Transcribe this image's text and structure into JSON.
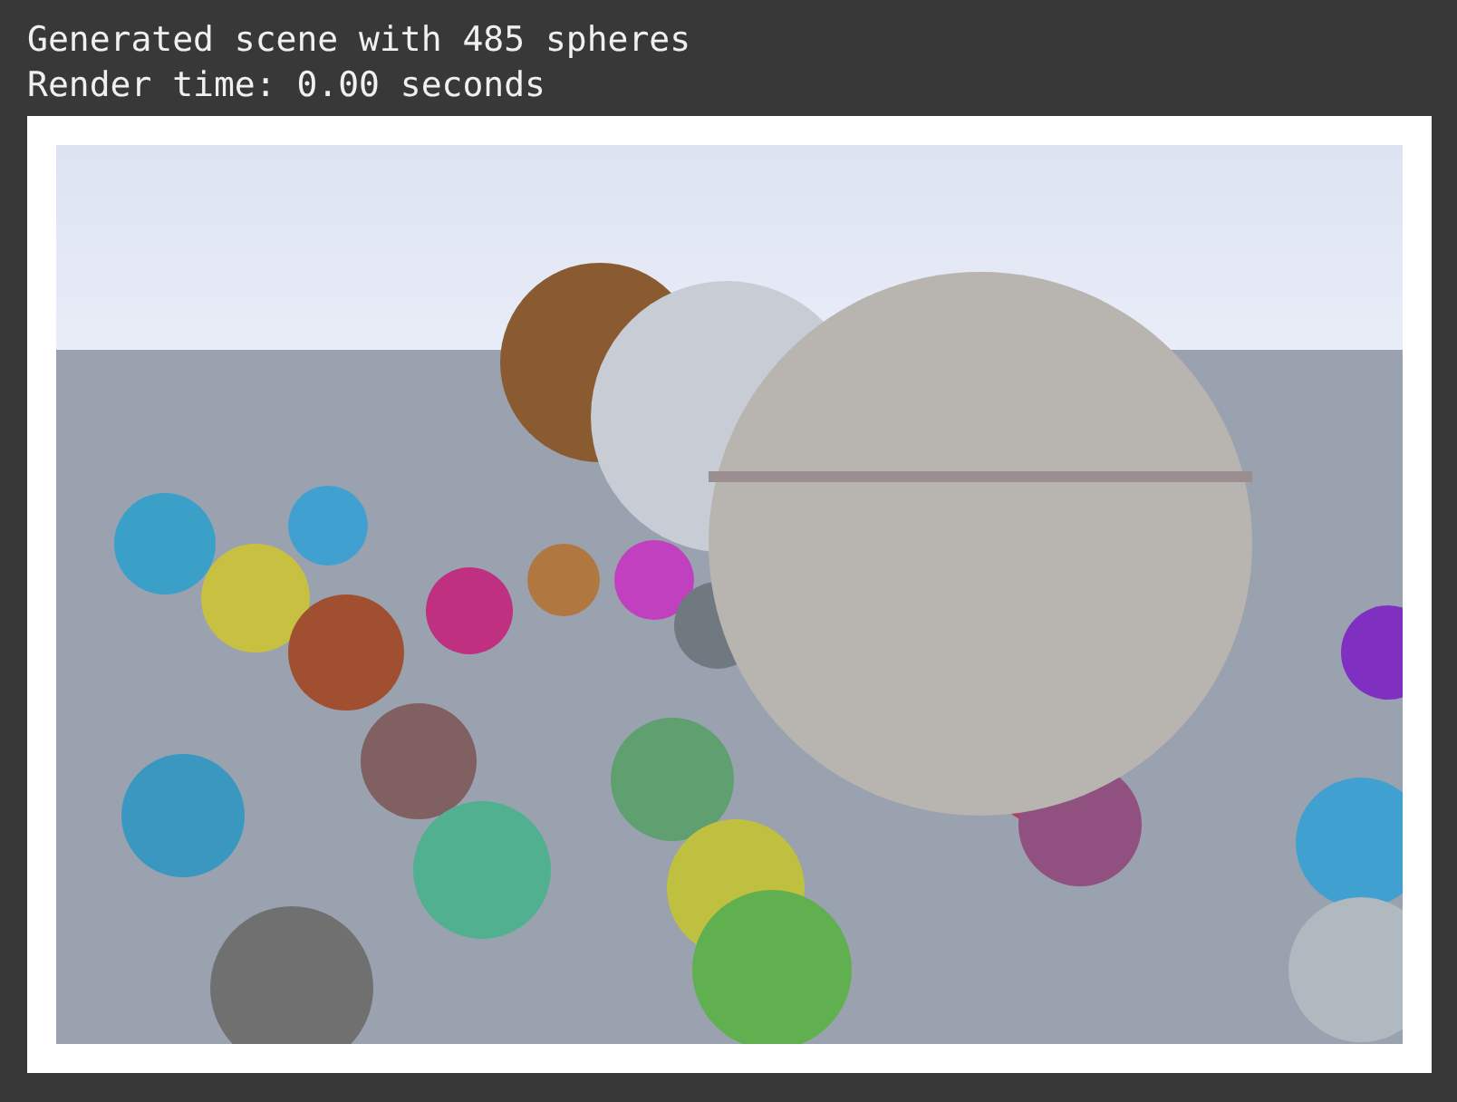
{
  "output_lines": [
    "Generated scene with 485 spheres",
    "Render time: 0.00 seconds"
  ]
}
